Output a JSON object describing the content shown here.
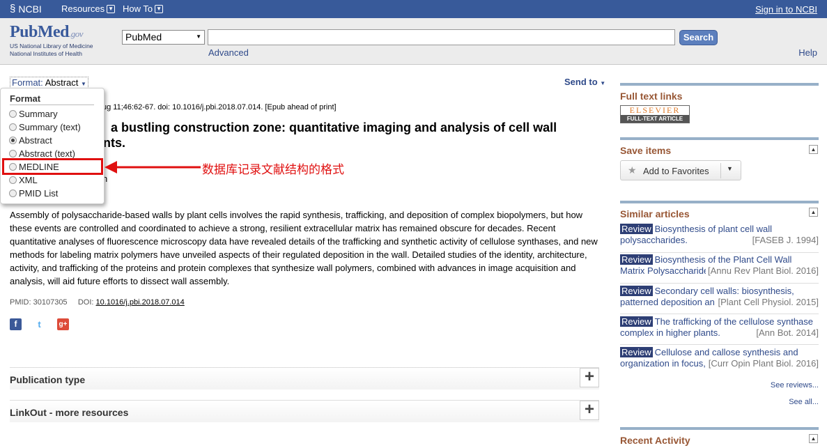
{
  "ncbi_bar": {
    "logo": "NCBI",
    "resources": "Resources",
    "howto": "How To",
    "signin": "Sign in to NCBI"
  },
  "header": {
    "brand_pub": "Pub",
    "brand_med": "Med",
    "brand_gov": ".gov",
    "sub1": "US National Library of Medicine",
    "sub2": "National Institutes of Health",
    "db_value": "PubMed",
    "search_value": "",
    "search_label": "Search",
    "advanced": "Advanced",
    "help": "Help"
  },
  "format": {
    "label": "Format",
    "value": "Abstract",
    "send_to": "Send to",
    "dropdown_header": "Format",
    "options": [
      "Summary",
      "Summary (text)",
      "Abstract",
      "Abstract (text)",
      "MEDLINE",
      "XML",
      "PMID List"
    ],
    "selected_index": 2
  },
  "annotation": {
    "text": "数据库记录文献结构的格式",
    "color": "#e01010"
  },
  "article": {
    "citation": "ug 11;46:62-67. doi: 10.1016/j.pbi.2018.07.014. [Epub ahead of print]",
    "title_line1": "a bustling construction zone: quantitative imaging and analysis of cell wall",
    "title_line2": "nts.",
    "author_tail": "n",
    "abstract": "Assembly of polysaccharide-based walls by plant cells involves the rapid synthesis, trafficking, and deposition of complex biopolymers, but how these events are controlled and coordinated to achieve a strong, resilient extracellular matrix has remained obscure for decades. Recent quantitative analyses of fluorescence microscopy data have revealed details of the trafficking and synthetic activity of cellulose synthases, and new methods for labeling matrix polymers have unveiled aspects of their regulated deposition in the wall. Detailed studies of the identity, architecture, activity, and trafficking of the proteins and protein complexes that synthesize wall polymers, combined with advances in image acquisition and analysis, will aid future efforts to dissect wall assembly.",
    "pmid": "PMID: 30107305",
    "doi_label": "DOI:",
    "doi": "10.1016/j.pbi.2018.07.014",
    "social": [
      "f",
      "t",
      "g+"
    ],
    "sections": [
      "Publication type",
      "LinkOut - more resources"
    ]
  },
  "sidebar": {
    "full_text_links": "Full text links",
    "elsevier_top": "ELSEVIER",
    "elsevier_bottom": "FULL-TEXT ARTICLE",
    "save_items": "Save items",
    "add_to_favorites": "Add to Favorites",
    "similar_articles": "Similar articles",
    "similar": [
      {
        "badge": "Review",
        "title": "Biosynthesis of plant cell wall polysaccharides.",
        "source": "[FASEB J. 1994]"
      },
      {
        "badge": "Review",
        "title": "Biosynthesis of the Plant Cell Wall Matrix Polysaccharide",
        "source": "[Annu Rev Plant Biol. 2016]"
      },
      {
        "badge": "Review",
        "title": "Secondary cell walls: biosynthesis, patterned deposition an",
        "source": "[Plant Cell Physiol. 2015]"
      },
      {
        "badge": "Review",
        "title": "The trafficking of the cellulose synthase complex in higher plants.",
        "source": "[Ann Bot. 2014]"
      },
      {
        "badge": "Review",
        "title": "Cellulose and callose synthesis and organization in focus,",
        "source": "[Curr Opin Plant Biol. 2016]"
      }
    ],
    "see_reviews": "See reviews...",
    "see_all": "See all...",
    "recent_activity": "Recent Activity"
  }
}
